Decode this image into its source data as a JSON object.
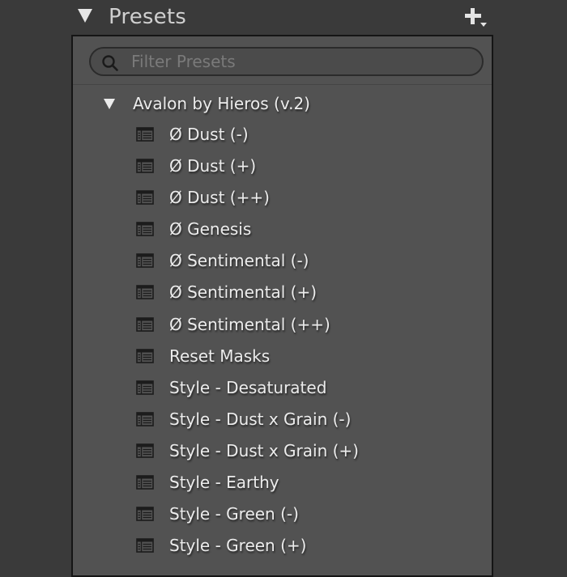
{
  "panel": {
    "title": "Presets",
    "add_icon": "plus-dropdown-icon"
  },
  "search": {
    "placeholder": "Filter Presets",
    "value": "",
    "icon": "search-icon"
  },
  "group": {
    "label": "Avalon by Hieros (v.2)",
    "expanded": true
  },
  "presets": [
    {
      "label": "Ø Dust (-)"
    },
    {
      "label": "Ø Dust (+)"
    },
    {
      "label": "Ø Dust (++)"
    },
    {
      "label": "Ø Genesis"
    },
    {
      "label": "Ø Sentimental (-)"
    },
    {
      "label": "Ø Sentimental (+)"
    },
    {
      "label": "Ø Sentimental (++)"
    },
    {
      "label": "Reset Masks"
    },
    {
      "label": "Style - Desaturated"
    },
    {
      "label": "Style - Dust x Grain (-)"
    },
    {
      "label": "Style - Dust x Grain (+)"
    },
    {
      "label": "Style - Earthy"
    },
    {
      "label": "Style - Green (-)"
    },
    {
      "label": "Style - Green (+)"
    }
  ],
  "colors": {
    "background": "#3a3a3a",
    "panel": "#525252",
    "text": "#ececec",
    "header_text": "#cfcfcf",
    "placeholder": "#7a7a7a"
  }
}
